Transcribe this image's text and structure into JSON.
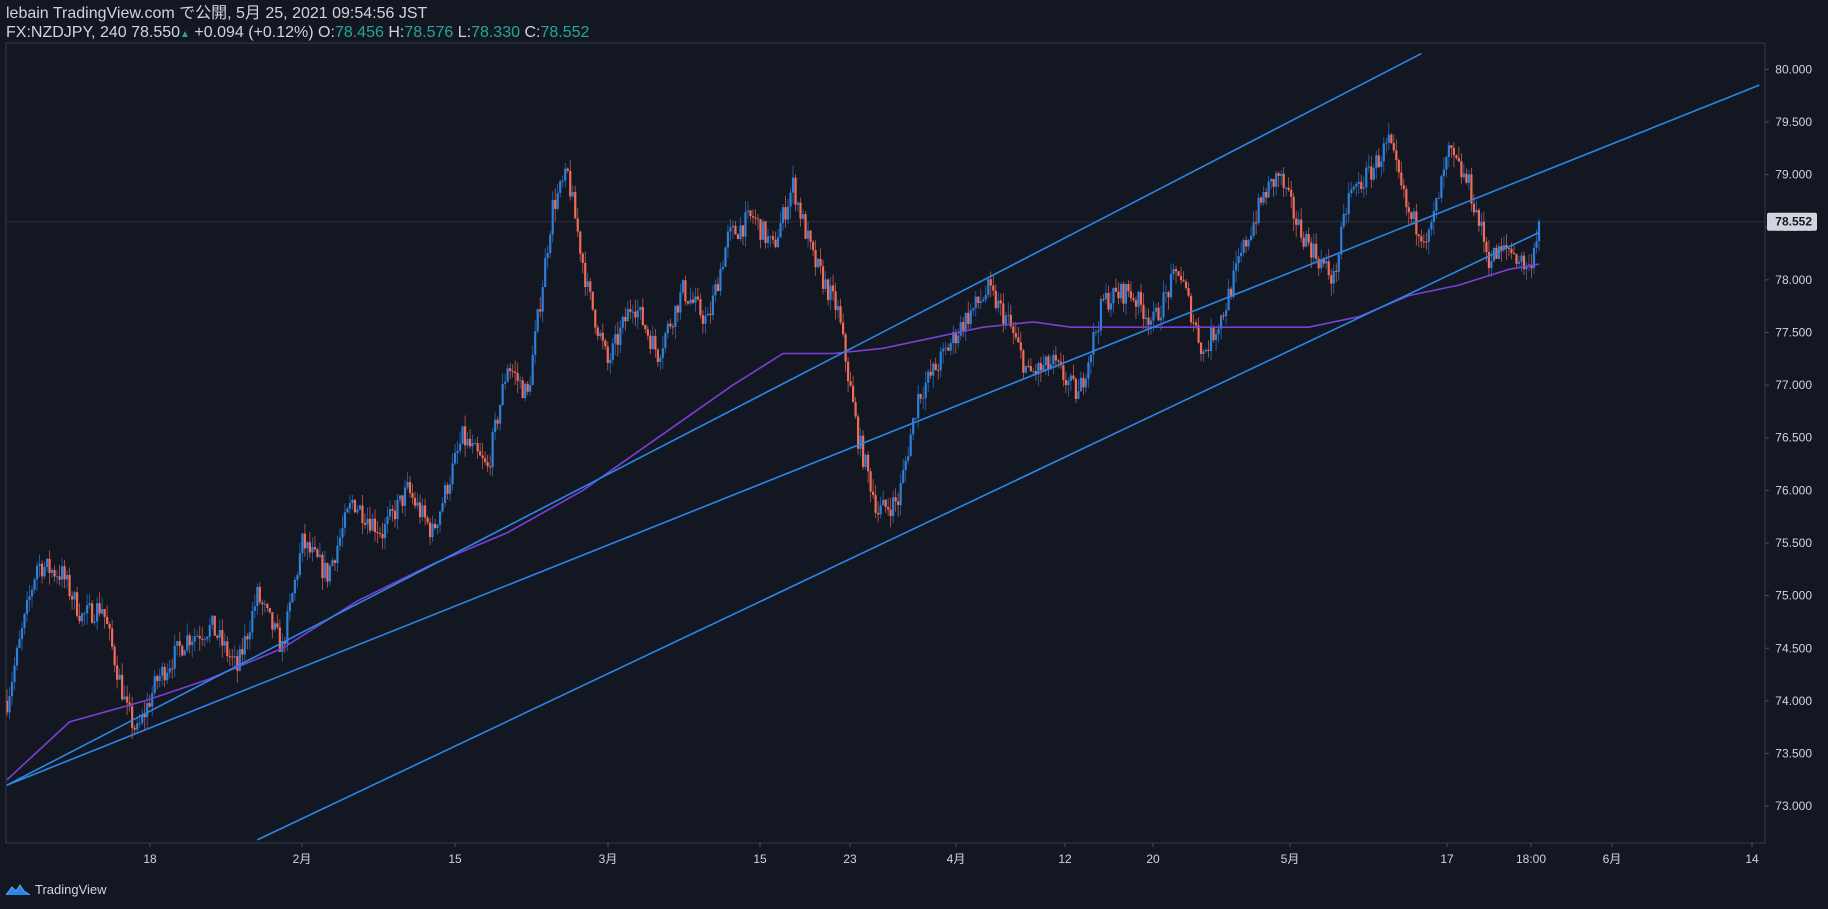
{
  "header": {
    "line1": "lebain TradingView.com で公開, 5月 25, 2021 09:54:56 JST",
    "symbol": "FX:NZDJPY, 240",
    "last": "78.550",
    "change_arrow": "▲",
    "change": "+0.094 (+0.12%)",
    "o_label": "O:",
    "o": "78.456",
    "h_label": "H:",
    "h": "78.576",
    "l_label": "L:",
    "l": "78.330",
    "c_label": "C:",
    "c": "78.552"
  },
  "footer": {
    "brand": "TradingView",
    "logo_icon": "tradingview-logo-icon"
  },
  "colors": {
    "background": "#131722",
    "up": "#2f7ed8",
    "down": "#ef6c5a",
    "trendline": "#2b86e8",
    "moving_average": "#7b3fd6",
    "axis_text": "#d1d4dc",
    "current_price_tag": "#d1d4dc"
  },
  "chart_data": {
    "type": "candlestick",
    "symbol": "FX:NZDJPY",
    "timeframe": "240",
    "y_ticks": [
      "80.000",
      "79.500",
      "79.000",
      "78.500",
      "78.000",
      "77.500",
      "77.000",
      "76.500",
      "76.000",
      "75.500",
      "75.000",
      "74.500",
      "74.000",
      "73.500",
      "73.000"
    ],
    "ylim": [
      72.65,
      80.25
    ],
    "x_tick_labels": [
      "18",
      "2月",
      "15",
      "3月",
      "15",
      "23",
      "4月",
      "12",
      "20",
      "5月",
      "17",
      "18:00",
      "6月",
      "14"
    ],
    "current_price": "78.552",
    "price_path": [
      {
        "t": 0,
        "p": 74.0
      },
      {
        "t": 12,
        "p": 75.3
      },
      {
        "t": 22,
        "p": 75.2
      },
      {
        "t": 30,
        "p": 74.8
      },
      {
        "t": 38,
        "p": 74.9
      },
      {
        "t": 48,
        "p": 73.9
      },
      {
        "t": 52,
        "p": 73.7
      },
      {
        "t": 60,
        "p": 74.2
      },
      {
        "t": 72,
        "p": 74.6
      },
      {
        "t": 82,
        "p": 74.7
      },
      {
        "t": 92,
        "p": 74.3
      },
      {
        "t": 100,
        "p": 75.0
      },
      {
        "t": 110,
        "p": 74.5
      },
      {
        "t": 118,
        "p": 75.5
      },
      {
        "t": 128,
        "p": 75.2
      },
      {
        "t": 138,
        "p": 75.9
      },
      {
        "t": 150,
        "p": 75.6
      },
      {
        "t": 160,
        "p": 76.0
      },
      {
        "t": 170,
        "p": 75.6
      },
      {
        "t": 182,
        "p": 76.5
      },
      {
        "t": 192,
        "p": 76.2
      },
      {
        "t": 200,
        "p": 77.2
      },
      {
        "t": 208,
        "p": 76.9
      },
      {
        "t": 218,
        "p": 78.7
      },
      {
        "t": 224,
        "p": 79.0
      },
      {
        "t": 232,
        "p": 77.9
      },
      {
        "t": 240,
        "p": 77.2
      },
      {
        "t": 250,
        "p": 77.8
      },
      {
        "t": 260,
        "p": 77.3
      },
      {
        "t": 270,
        "p": 77.9
      },
      {
        "t": 280,
        "p": 77.6
      },
      {
        "t": 288,
        "p": 78.4
      },
      {
        "t": 298,
        "p": 78.6
      },
      {
        "t": 306,
        "p": 78.3
      },
      {
        "t": 314,
        "p": 78.9
      },
      {
        "t": 322,
        "p": 78.2
      },
      {
        "t": 332,
        "p": 77.7
      },
      {
        "t": 340,
        "p": 76.5
      },
      {
        "t": 348,
        "p": 75.8
      },
      {
        "t": 356,
        "p": 75.9
      },
      {
        "t": 364,
        "p": 76.9
      },
      {
        "t": 372,
        "p": 77.2
      },
      {
        "t": 382,
        "p": 77.6
      },
      {
        "t": 392,
        "p": 77.9
      },
      {
        "t": 400,
        "p": 77.6
      },
      {
        "t": 408,
        "p": 77.1
      },
      {
        "t": 418,
        "p": 77.2
      },
      {
        "t": 428,
        "p": 76.9
      },
      {
        "t": 438,
        "p": 77.8
      },
      {
        "t": 448,
        "p": 77.9
      },
      {
        "t": 458,
        "p": 77.6
      },
      {
        "t": 468,
        "p": 78.1
      },
      {
        "t": 478,
        "p": 77.3
      },
      {
        "t": 486,
        "p": 77.7
      },
      {
        "t": 494,
        "p": 78.3
      },
      {
        "t": 502,
        "p": 78.8
      },
      {
        "t": 508,
        "p": 79.0
      },
      {
        "t": 516,
        "p": 78.5
      },
      {
        "t": 524,
        "p": 78.2
      },
      {
        "t": 530,
        "p": 78.0
      },
      {
        "t": 536,
        "p": 78.8
      },
      {
        "t": 544,
        "p": 79.0
      },
      {
        "t": 552,
        "p": 79.3
      },
      {
        "t": 560,
        "p": 78.6
      },
      {
        "t": 568,
        "p": 78.4
      },
      {
        "t": 576,
        "p": 79.2
      },
      {
        "t": 584,
        "p": 78.9
      },
      {
        "t": 592,
        "p": 78.2
      },
      {
        "t": 600,
        "p": 78.3
      },
      {
        "t": 608,
        "p": 78.1
      },
      {
        "t": 612,
        "p": 78.55
      }
    ],
    "moving_average": [
      {
        "t": 0,
        "p": 73.25
      },
      {
        "t": 25,
        "p": 73.8
      },
      {
        "t": 55,
        "p": 74.0
      },
      {
        "t": 80,
        "p": 74.2
      },
      {
        "t": 110,
        "p": 74.5
      },
      {
        "t": 140,
        "p": 74.95
      },
      {
        "t": 170,
        "p": 75.3
      },
      {
        "t": 200,
        "p": 75.6
      },
      {
        "t": 230,
        "p": 76.0
      },
      {
        "t": 260,
        "p": 76.5
      },
      {
        "t": 290,
        "p": 77.0
      },
      {
        "t": 310,
        "p": 77.3
      },
      {
        "t": 330,
        "p": 77.3
      },
      {
        "t": 350,
        "p": 77.35
      },
      {
        "t": 370,
        "p": 77.45
      },
      {
        "t": 390,
        "p": 77.55
      },
      {
        "t": 410,
        "p": 77.6
      },
      {
        "t": 425,
        "p": 77.55
      },
      {
        "t": 440,
        "p": 77.55
      },
      {
        "t": 470,
        "p": 77.55
      },
      {
        "t": 500,
        "p": 77.55
      },
      {
        "t": 520,
        "p": 77.55
      },
      {
        "t": 540,
        "p": 77.65
      },
      {
        "t": 560,
        "p": 77.85
      },
      {
        "t": 580,
        "p": 77.95
      },
      {
        "t": 600,
        "p": 78.1
      },
      {
        "t": 612,
        "p": 78.15
      }
    ],
    "trendlines": [
      {
        "name": "channel-upper",
        "from": {
          "t": 0,
          "p": 73.2
        },
        "to": {
          "t": 565,
          "p": 80.15
        }
      },
      {
        "name": "channel-middle",
        "from": {
          "t": 0,
          "p": 73.2
        },
        "to": {
          "t": 700,
          "p": 79.85
        }
      },
      {
        "name": "channel-lower",
        "from": {
          "t": 100,
          "p": 72.68
        },
        "to": {
          "t": 612,
          "p": 78.45
        }
      }
    ]
  }
}
